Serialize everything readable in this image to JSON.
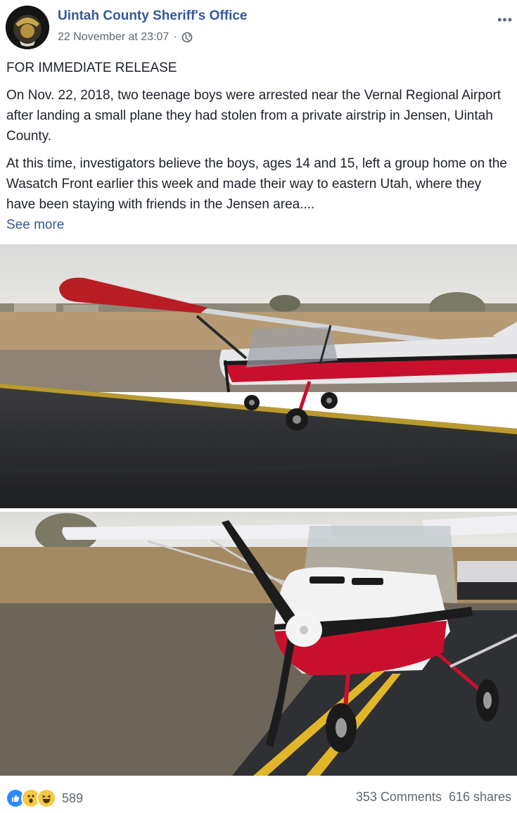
{
  "post": {
    "page_name": "Uintah County Sheriff's Office",
    "timestamp": "22 November at 23:07",
    "separator": "·",
    "privacy_icon": "globe-icon",
    "more_icon": "ellipsis-icon",
    "more_label": "•••"
  },
  "content": {
    "headline": "FOR IMMEDIATE RELEASE",
    "paragraph1": "On Nov. 22, 2018, two teenage boys were arrested near the Vernal Regional Airport after landing a small plane they had stolen from a private airstrip in Jensen, Uintah County.",
    "paragraph2": "At this time, investigators believe the boys, ages 14 and 15, left a group home on the Wasatch Front earlier this week and made their way to eastern Utah, where they have been staying with friends in the Jensen area....",
    "see_more": "See more"
  },
  "footer": {
    "reaction_icons": [
      "like-icon",
      "wow-icon",
      "haha-icon"
    ],
    "reaction_count": "589",
    "comments": "353 Comments",
    "shares": "616 shares"
  },
  "colors": {
    "link": "#365899",
    "text": "#1d2129",
    "meta": "#606770",
    "plane_red": "#c8102e"
  }
}
